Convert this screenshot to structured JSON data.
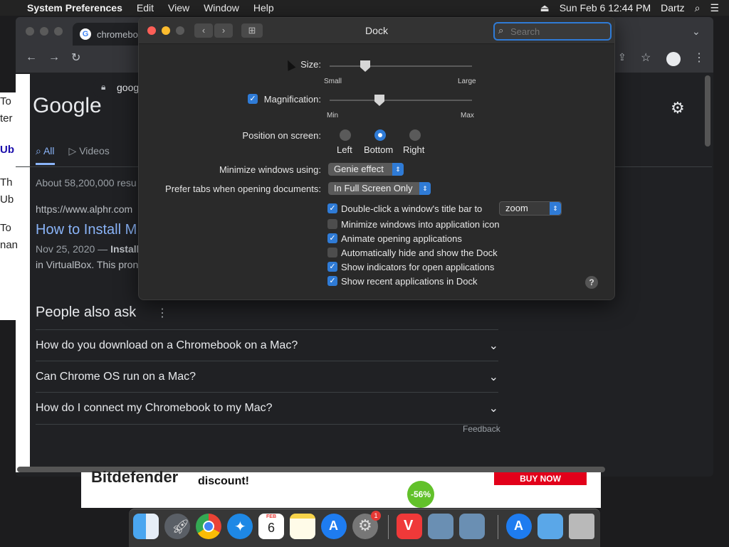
{
  "menubar": {
    "apple": "",
    "app": "System Preferences",
    "menus": [
      "Edit",
      "View",
      "Window",
      "Help"
    ],
    "datetime": "Sun Feb 6  12:44 PM",
    "user": "Dartz"
  },
  "chrome": {
    "tab_title": "chromebo",
    "address": "goog",
    "logo": "Google",
    "tabs": [
      "All",
      "Videos"
    ],
    "results_count": "About 58,200,000 resu",
    "result_url": "https://www.alphr.com",
    "result_title": "How to Install M",
    "result_date": "Nov 25, 2020 — ",
    "result_bold": "Install",
    "result_snippet": "in VirtualBox. This pron",
    "left_fragments": [
      "To",
      "ter",
      "Ub",
      "Th",
      "Ub",
      "To",
      "nan"
    ],
    "paa_title": "People also ask",
    "paa_questions": [
      "How do you download on a Chromebook on a Mac?",
      "Can Chrome OS run on a Mac?",
      "How do I connect my Chromebook to my Mac?"
    ],
    "feedback": "Feedback"
  },
  "ad": {
    "brand": "Bitdefender",
    "discount": "discount!",
    "badge": "-56%",
    "cta": "BUY NOW"
  },
  "dock_prefs": {
    "title": "Dock",
    "search_placeholder": "Search",
    "size_label": "Size:",
    "size_min": "Small",
    "size_max": "Large",
    "size_value": 0.25,
    "magnification_label": "Magnification:",
    "magnification_checked": true,
    "mag_min": "Min",
    "mag_max": "Max",
    "mag_value": 0.35,
    "position_label": "Position on screen:",
    "positions": [
      "Left",
      "Bottom",
      "Right"
    ],
    "position_selected": "Bottom",
    "minimize_label": "Minimize windows using:",
    "minimize_value": "Genie effect",
    "tabs_label": "Prefer tabs when opening documents:",
    "tabs_value": "In Full Screen Only",
    "dblclick_label": "Double-click a window's title bar to",
    "dblclick_value": "zoom",
    "options": [
      {
        "label": "Minimize windows into application icon",
        "checked": false
      },
      {
        "label": "Animate opening applications",
        "checked": true
      },
      {
        "label": "Automatically hide and show the Dock",
        "checked": false
      },
      {
        "label": "Show indicators for open applications",
        "checked": true
      },
      {
        "label": "Show recent applications in Dock",
        "checked": true
      }
    ],
    "help": "?"
  },
  "dock": {
    "calendar_month": "FEB",
    "calendar_day": "6",
    "badge": "1"
  },
  "colors": {
    "accent": "#2f7bd6",
    "close": "#fe5f57",
    "minimize": "#febc2e",
    "link": "#8ab4f8"
  }
}
